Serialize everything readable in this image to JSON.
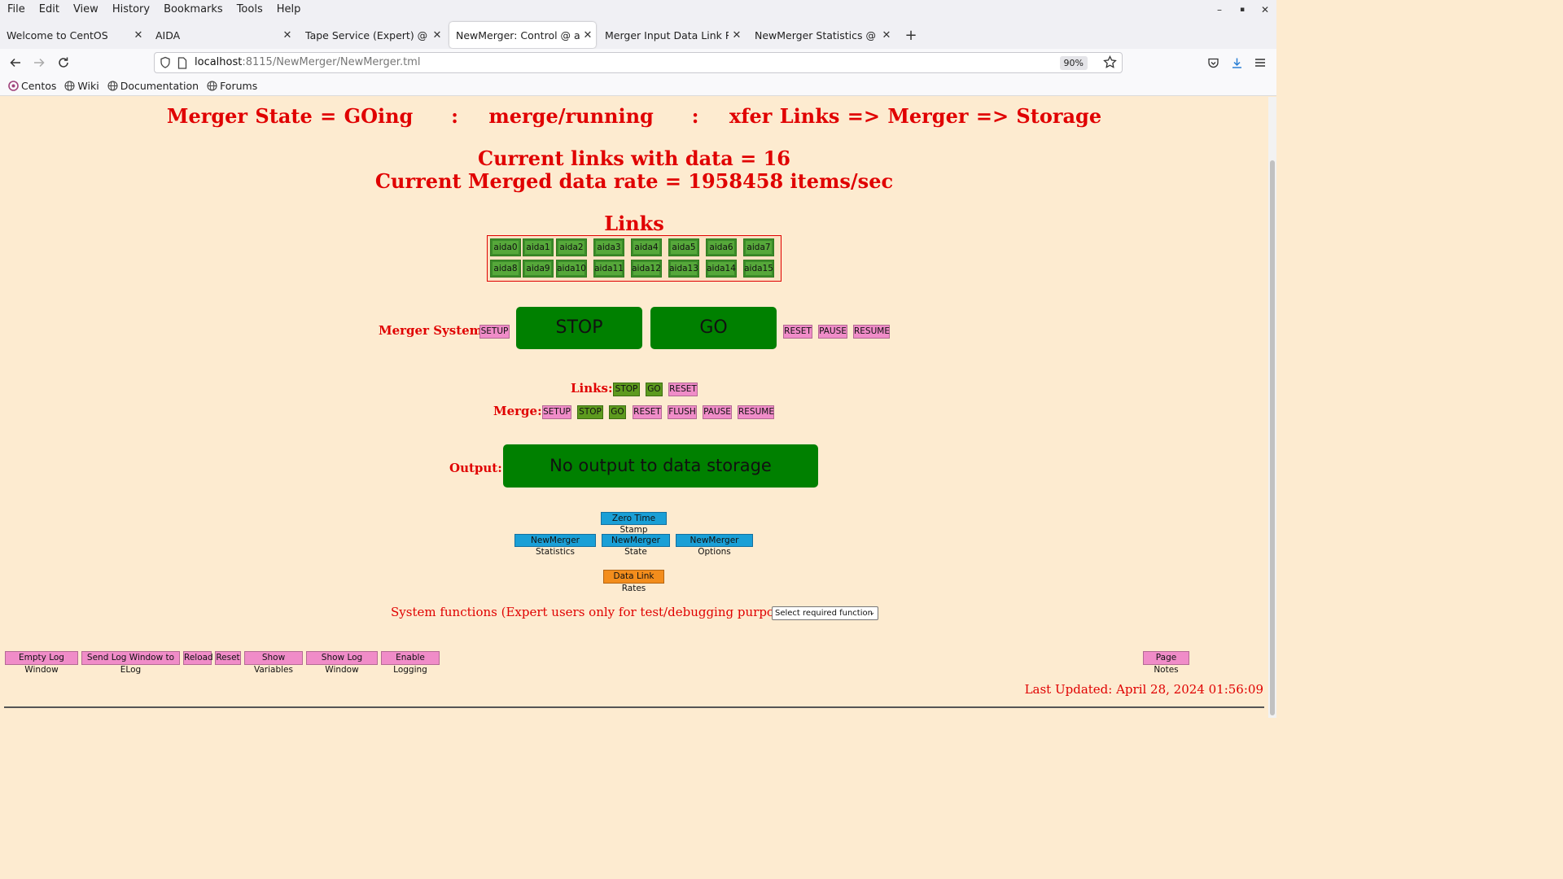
{
  "menu": [
    "File",
    "Edit",
    "View",
    "History",
    "Bookmarks",
    "Tools",
    "Help"
  ],
  "window_controls": {
    "minimize": "–",
    "maximize": "▪",
    "close": "✕"
  },
  "tabs": [
    {
      "label": "Welcome to CentOS",
      "active": false
    },
    {
      "label": "AIDA",
      "active": false
    },
    {
      "label": "Tape Service (Expert) @ aidas",
      "active": false
    },
    {
      "label": "NewMerger: Control @ aidas",
      "active": true
    },
    {
      "label": "Merger Input Data Link Rates",
      "active": false
    },
    {
      "label": "NewMerger Statistics @ aidas",
      "active": false
    }
  ],
  "new_tab": "+",
  "address": {
    "host": "localhost",
    "path": ":8115/NewMerger/NewMerger.tml",
    "zoom": "90%"
  },
  "bookmarks": [
    "Centos",
    "Wiki",
    "Documentation",
    "Forums"
  ],
  "page": {
    "state_line": "Merger State = GOing     :    merge/running     :    xfer Links => Merger => Storage",
    "links_line": "Current links with data = 16",
    "rate_line": "Current Merged data rate = 1958458 items/sec",
    "links_title": "Links",
    "link_names": [
      "aida0",
      "aida1",
      "aida2",
      "aida3",
      "aida4",
      "aida5",
      "aida6",
      "aida7",
      "aida8",
      "aida9",
      "aida10",
      "aida11",
      "aida12",
      "aida13",
      "aida14",
      "aida15"
    ],
    "merger_system": {
      "label": "Merger System:",
      "setup": "SETUP",
      "stop": "STOP",
      "go": "GO",
      "reset": "RESET",
      "pause": "PAUSE",
      "resume": "RESUME"
    },
    "links_ctrl": {
      "label": "Links:",
      "stop": "STOP",
      "go": "GO",
      "reset": "RESET"
    },
    "merge_ctrl": {
      "label": "Merge:",
      "setup": "SETUP",
      "stop": "STOP",
      "go": "GO",
      "reset": "RESET",
      "flush": "FLUSH",
      "pause": "PAUSE",
      "resume": "RESUME"
    },
    "output": {
      "label": "Output:",
      "value": "No output to data storage"
    },
    "zero_time_stamp": "Zero Time Stamp",
    "stats_buttons": [
      "NewMerger Statistics",
      "NewMerger State",
      "NewMerger Options"
    ],
    "data_link_rates": "Data Link Rates",
    "system_functions": {
      "label": "System functions (Expert users only for test/debugging purposes!!!)",
      "selected": "Select required function"
    },
    "bottom_buttons": [
      "Empty Log Window",
      "Send Log Window to ELog",
      "Reload",
      "Reset",
      "Show Variables",
      "Show Log Window",
      "Enable Logging"
    ],
    "page_notes": "Page Notes",
    "last_updated": "Last Updated: April 28, 2024 01:56:09"
  },
  "colors": {
    "page_bg": "#fdebd0",
    "accent_red": "#e00000",
    "green_button": "#008000",
    "pink_button": "#f08cc8",
    "blue_button": "#1a9fd6",
    "orange_button": "#f38d1c"
  }
}
